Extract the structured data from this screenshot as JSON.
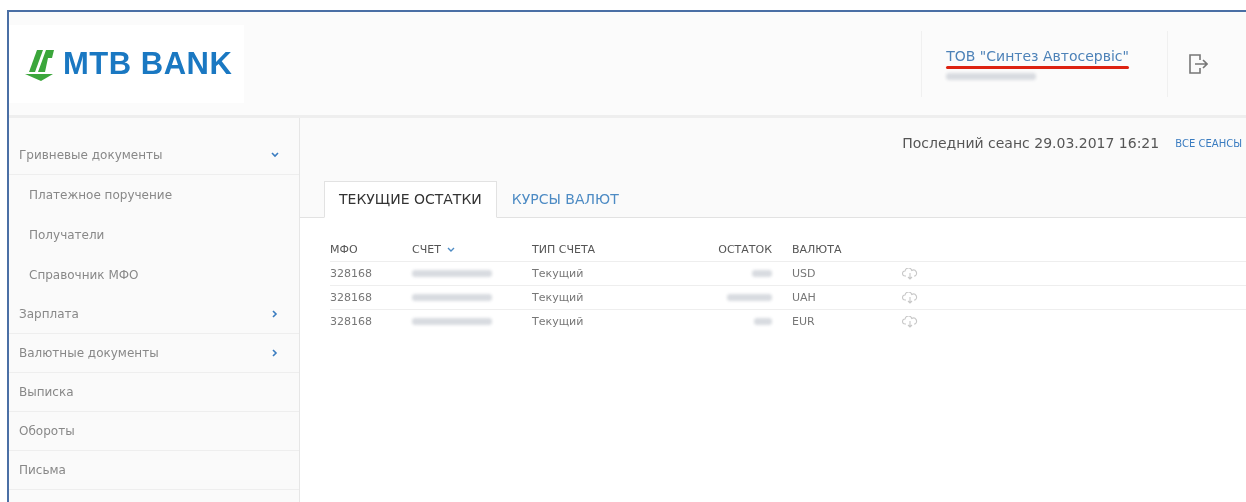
{
  "header": {
    "logo_text": "MTB BANK",
    "company": "ТОВ \"Синтез Автосервіс\""
  },
  "sidebar": {
    "items": [
      {
        "label": "Гривневые документы",
        "expanded": true,
        "children": [
          {
            "label": "Платежное поручение"
          },
          {
            "label": "Получатели"
          },
          {
            "label": "Справочник МФО"
          }
        ]
      },
      {
        "label": "Зарплата",
        "expanded": false
      },
      {
        "label": "Валютные документы",
        "expanded": false
      },
      {
        "label": "Выписка"
      },
      {
        "label": "Обороты"
      },
      {
        "label": "Письма"
      }
    ]
  },
  "session": {
    "label": "Последний сеанс 29.03.2017 16:21",
    "link": "ВСЕ СЕАНСЫ"
  },
  "tabs": [
    {
      "label": "ТЕКУЩИЕ ОСТАТКИ",
      "selected": true
    },
    {
      "label": "КУРСЫ ВАЛЮТ",
      "selected": false
    }
  ],
  "table": {
    "columns": [
      "МФО",
      "СЧЕТ",
      "ТИП СЧЕТА",
      "ОСТАТОК",
      "ВАЛЮТА"
    ],
    "rows": [
      {
        "mfo": "328168",
        "type": "Текущий",
        "currency": "USD"
      },
      {
        "mfo": "328168",
        "type": "Текущий",
        "currency": "UAH"
      },
      {
        "mfo": "328168",
        "type": "Текущий",
        "currency": "EUR"
      }
    ]
  }
}
